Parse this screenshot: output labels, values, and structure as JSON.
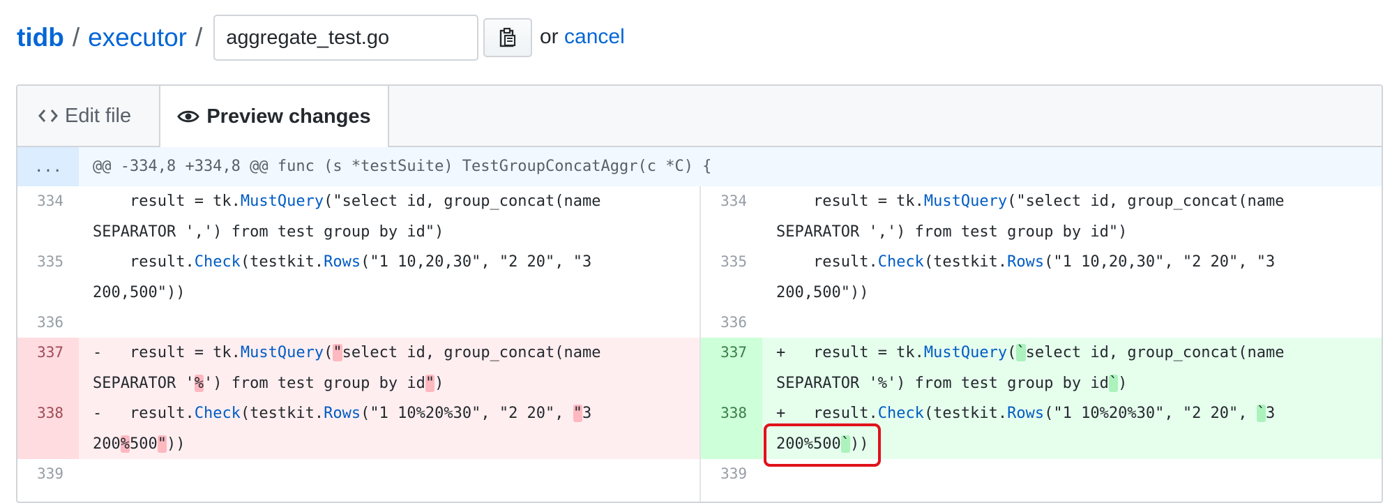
{
  "breadcrumb": {
    "owner": "tidb",
    "separator": "/",
    "repo": "executor",
    "filename": "aggregate_test.go"
  },
  "actions": {
    "or_label": "or",
    "cancel_label": "cancel",
    "clipboard_icon": "clipboard-icon"
  },
  "tabs": [
    {
      "label": "Edit file",
      "icon": "code-icon",
      "selected": false
    },
    {
      "label": "Preview changes",
      "icon": "eye-icon",
      "selected": true
    }
  ],
  "diff": {
    "hunk_expander": "...",
    "hunk_header": "@@ -334,8 +334,8 @@ func (s *testSuite) TestGroupConcatAggr(c *C) {",
    "left": [
      {
        "line": "334",
        "type": "context",
        "text": "    result = tk.MustQuery(\"select id, group_concat(name\nSEPARATOR ',') from test group by id\")"
      },
      {
        "line": "335",
        "type": "context",
        "text": "    result.Check(testkit.Rows(\"1 10,20,30\", \"2 20\", \"3\n200,500\"))"
      },
      {
        "line": "336",
        "type": "context",
        "text": ""
      },
      {
        "line": "337",
        "type": "deletion",
        "text": "-   result = tk.MustQuery(\"select id, group_concat(name\nSEPARATOR '%') from test group by id\")"
      },
      {
        "line": "338",
        "type": "deletion",
        "text": "-   result.Check(testkit.Rows(\"1 10%20%30\", \"2 20\", \"3\n200%500\"))"
      },
      {
        "line": "339",
        "type": "context",
        "text": ""
      }
    ],
    "right": [
      {
        "line": "334",
        "type": "context",
        "text": "    result = tk.MustQuery(\"select id, group_concat(name\nSEPARATOR ',') from test group by id\")"
      },
      {
        "line": "335",
        "type": "context",
        "text": "    result.Check(testkit.Rows(\"1 10,20,30\", \"2 20\", \"3\n200,500\"))"
      },
      {
        "line": "336",
        "type": "context",
        "text": ""
      },
      {
        "line": "337",
        "type": "addition",
        "text": "+   result = tk.MustQuery(`select id, group_concat(name\nSEPARATOR '%') from test group by id`)"
      },
      {
        "line": "338",
        "type": "addition",
        "text": "+   result.Check(testkit.Rows(\"1 10%20%30\", \"2 20\", `3\n200%500`))"
      },
      {
        "line": "339",
        "type": "context",
        "text": ""
      }
    ]
  },
  "colors": {
    "link": "#0366d6",
    "deletion_bg": "#ffeef0",
    "addition_bg": "#e6ffed",
    "callout": "#e0121b"
  }
}
